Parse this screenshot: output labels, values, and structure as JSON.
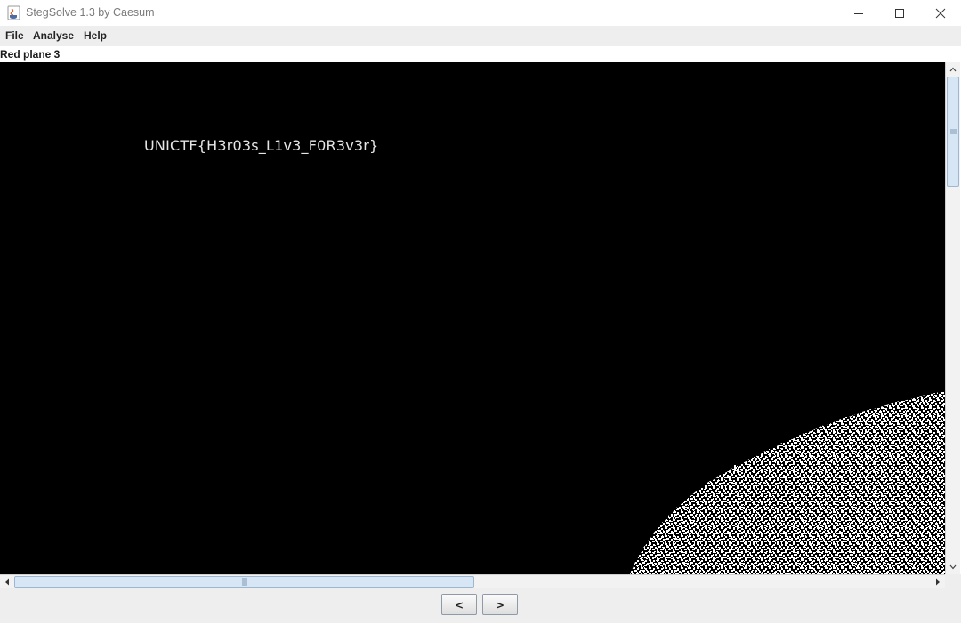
{
  "window": {
    "title": "StegSolve 1.3 by Caesum",
    "icon": "java-cup-icon",
    "controls": [
      "minimize-icon",
      "maximize-icon",
      "close-icon"
    ]
  },
  "menu": {
    "items": [
      {
        "label": "File"
      },
      {
        "label": "Analyse"
      },
      {
        "label": "Help"
      }
    ]
  },
  "view": {
    "plane_label": "Red plane 3",
    "hidden_text": "UNICTF{H3r03s_L1v3_F0R3v3r}"
  },
  "nav": {
    "prev_label": "<",
    "next_label": ">"
  },
  "colors": {
    "canvas": "#000000",
    "scroll_thumb": "#d6e6f5",
    "button_border": "#8e9aa8"
  }
}
